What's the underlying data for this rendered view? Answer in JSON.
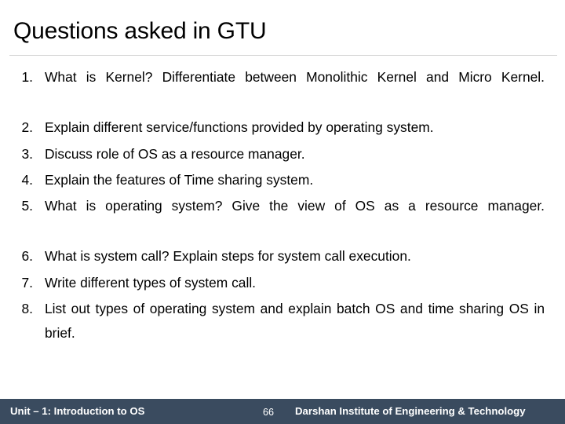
{
  "slide": {
    "title": "Questions asked in GTU",
    "questions": [
      {
        "number": "1.",
        "text": "What is Kernel? Differentiate between Monolithic Kernel and Micro Kernel.",
        "wraps": true
      },
      {
        "number": "2.",
        "text": "Explain different service/functions provided by operating system.",
        "wraps": false
      },
      {
        "number": "3.",
        "text": "Discuss role of OS as a resource manager.",
        "wraps": false
      },
      {
        "number": "4.",
        "text": "Explain the features of Time sharing system.",
        "wraps": false
      },
      {
        "number": "5.",
        "text": "What is operating system? Give the view of OS as a resource manager.",
        "wraps": true
      },
      {
        "number": "6.",
        "text": "What is system call? Explain steps for system call execution.",
        "wraps": false
      },
      {
        "number": "7.",
        "text": "Write different types of system call.",
        "wraps": false
      },
      {
        "number": "8.",
        "text": "List out types of operating system and explain batch OS and time sharing OS in brief.",
        "wraps": true
      }
    ]
  },
  "footer": {
    "unit_label": "Unit – 1: Introduction to OS",
    "page_number": "66",
    "institute": "Darshan Institute of Engineering & Technology",
    "background_color": "#3a4b5f",
    "text_color": "#ffffff"
  }
}
